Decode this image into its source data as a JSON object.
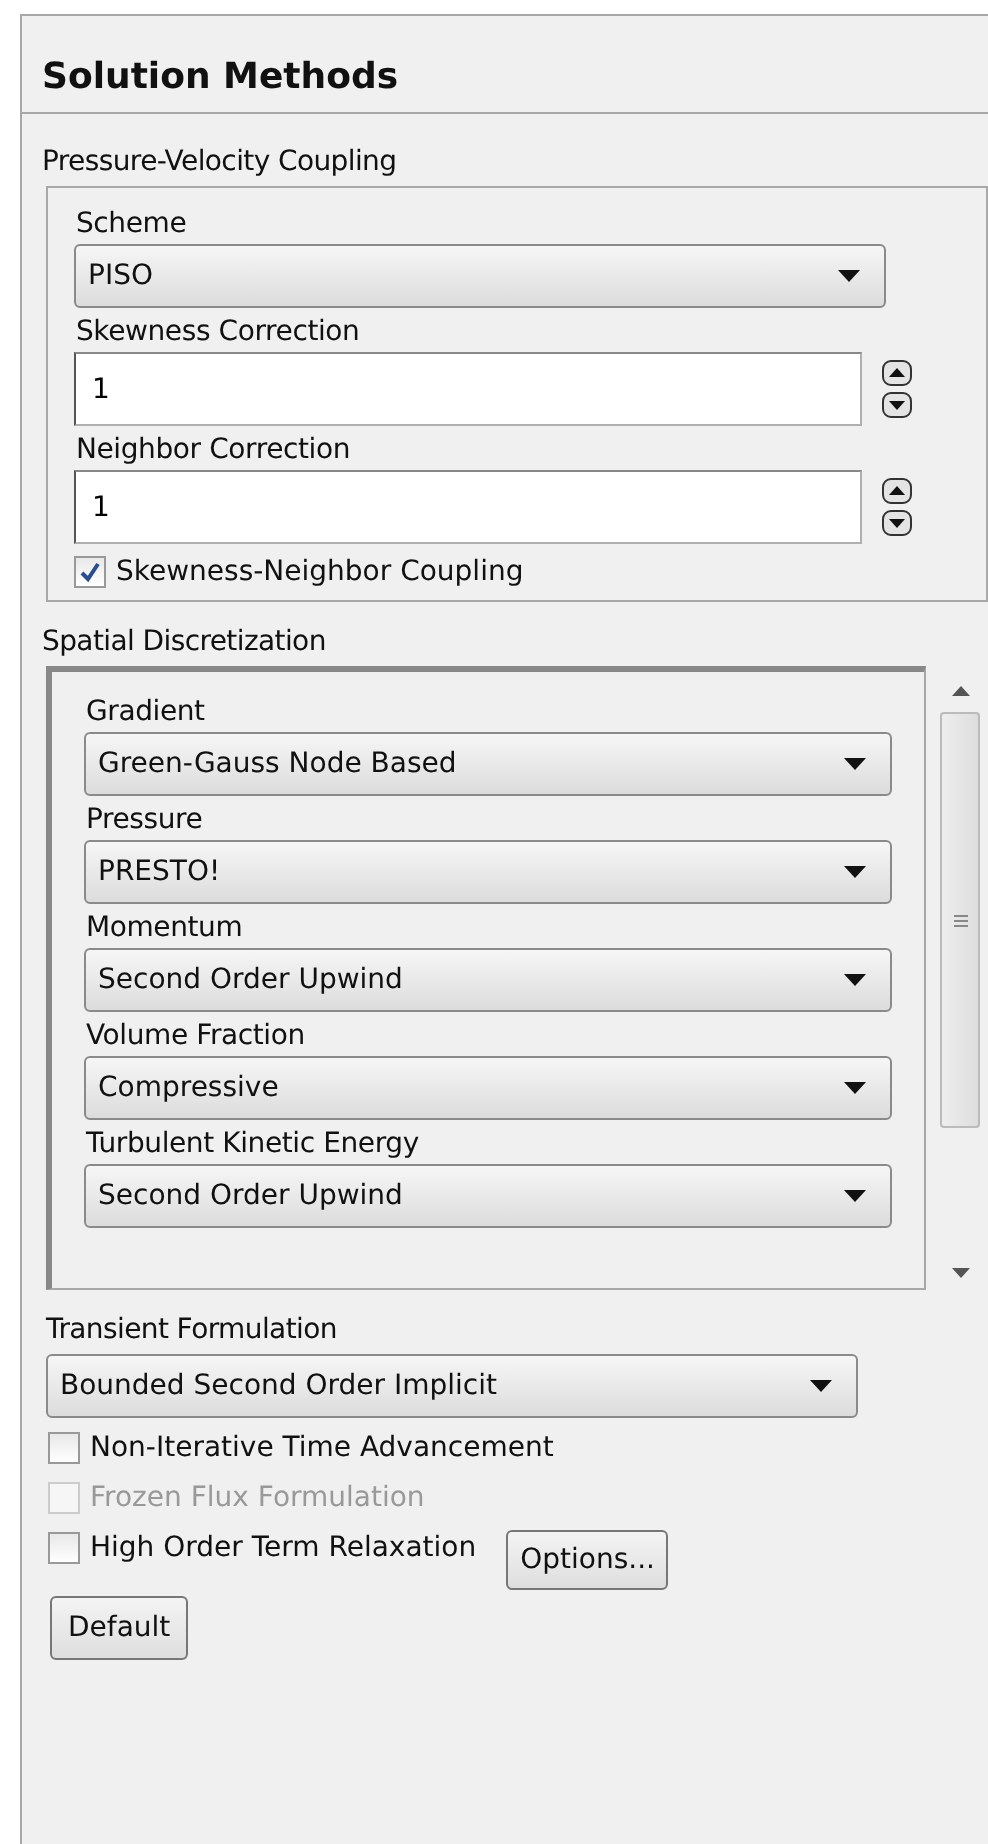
{
  "panel": {
    "title": "Solution Methods"
  },
  "pressure_velocity_coupling": {
    "label": "Pressure-Velocity Coupling",
    "scheme": {
      "label": "Scheme",
      "value": "PISO"
    },
    "fields": [
      {
        "label": "Skewness Correction",
        "value": "1"
      },
      {
        "label": "Neighbor Correction",
        "value": "1"
      }
    ],
    "option": {
      "label": "Skewness-Neighbor Coupling",
      "checked": true
    }
  },
  "spatial_discretization": {
    "label": "Spatial Discretization",
    "items": [
      {
        "label": "Gradient",
        "value": "Green-Gauss Node Based"
      },
      {
        "label": "Pressure",
        "value": "PRESTO!"
      },
      {
        "label": "Momentum",
        "value": "Second Order Upwind"
      },
      {
        "label": "Volume Fraction",
        "value": "Compressive"
      },
      {
        "label": "Turbulent Kinetic Energy",
        "value": "Second Order Upwind"
      }
    ]
  },
  "transient_formulation": {
    "label": "Transient Formulation",
    "value": "Bounded Second Order Implicit"
  },
  "options": [
    {
      "label": "Non-Iterative Time Advancement",
      "checked": false,
      "disabled": false
    },
    {
      "label": "Frozen Flux Formulation",
      "checked": false,
      "disabled": true
    },
    {
      "label": "High Order Term Relaxation",
      "checked": false,
      "disabled": false,
      "button": "Options..."
    }
  ],
  "default_button": "Default"
}
